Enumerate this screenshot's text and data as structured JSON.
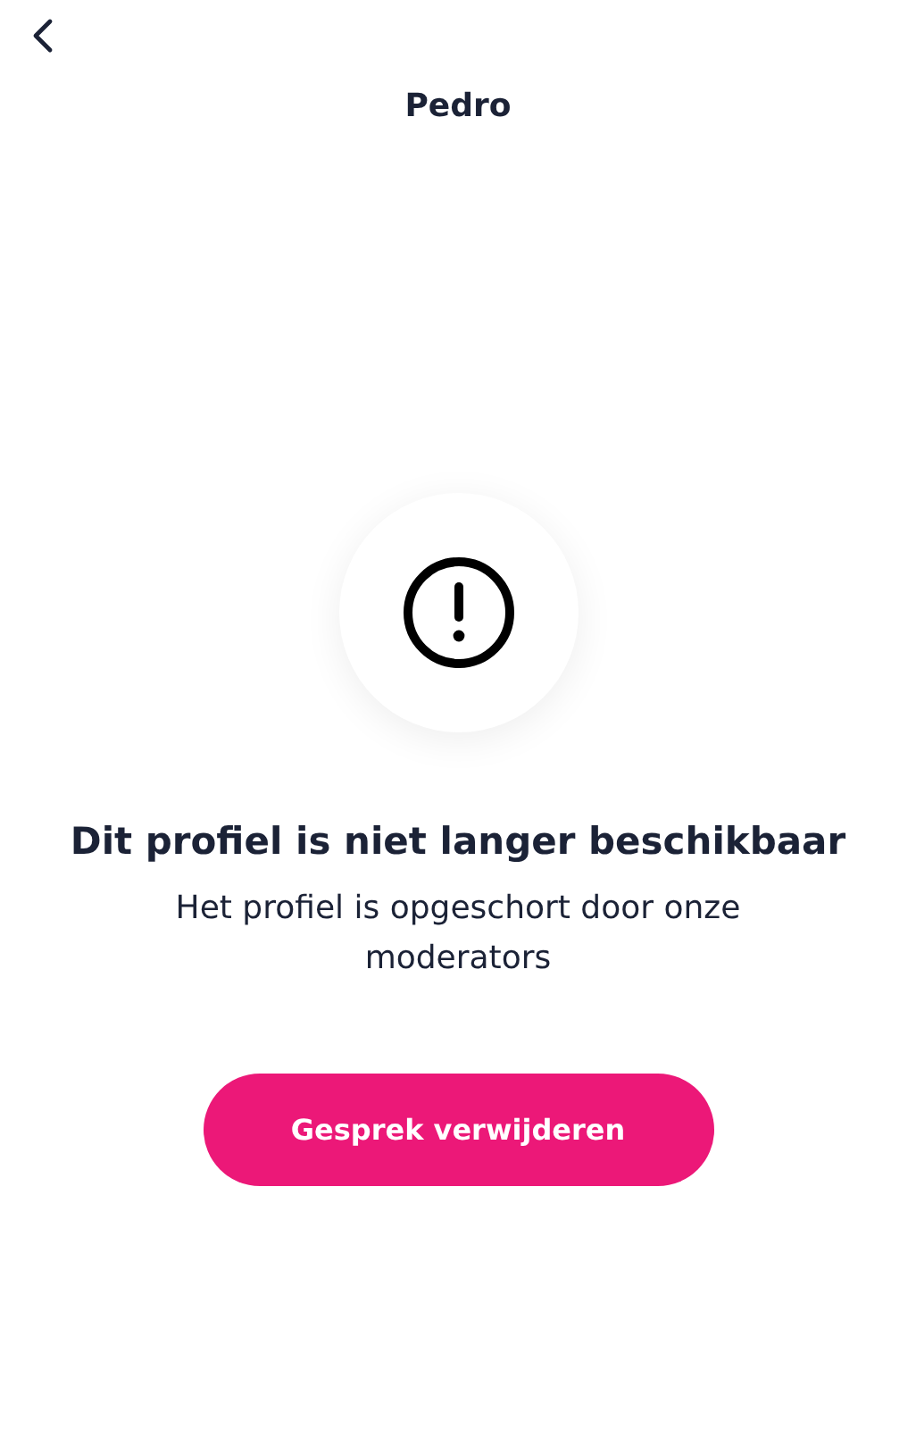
{
  "header": {
    "title": "Pedro"
  },
  "notice": {
    "title": "Dit profiel is niet langer beschikbaar",
    "message": "Het profiel is opgeschort door onze moderators"
  },
  "button": {
    "label": "Gesprek verwijderen"
  }
}
